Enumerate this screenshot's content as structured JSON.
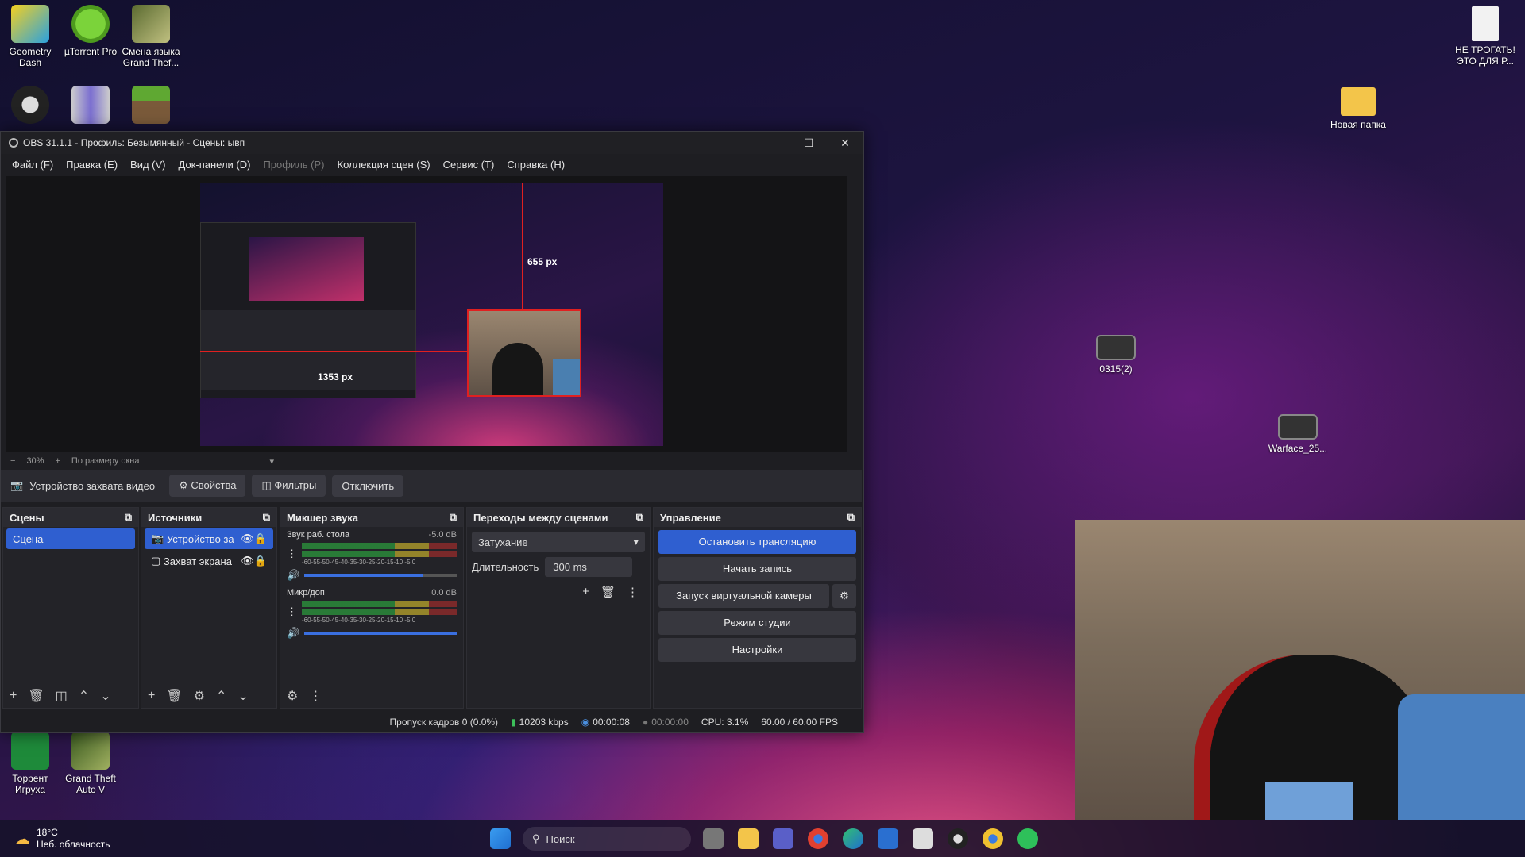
{
  "desktop": {
    "icons_left": [
      {
        "label": "Geometry Dash"
      },
      {
        "label": "µTorrent Pro"
      },
      {
        "label": "Смена языка Grand Thef..."
      },
      {
        "label": "Торрент Игруха"
      },
      {
        "label": "Grand Theft Auto V"
      }
    ],
    "icons_right": [
      {
        "label": "НЕ ТРОГАТЬ! ЭТО ДЛЯ Р..."
      },
      {
        "label": "Новая папка"
      },
      {
        "label": "0315(2)"
      },
      {
        "label": "Warface_25..."
      }
    ]
  },
  "obs": {
    "title": "OBS 31.1.1 - Профиль: Безымянный - Сцены: ывп",
    "menu": [
      "Файл (F)",
      "Правка (E)",
      "Вид (V)",
      "Док-панели (D)",
      "Профиль (P)",
      "Коллекция сцен (S)",
      "Сервис (T)",
      "Справка (H)"
    ],
    "preview": {
      "dim_vertical": "655 px",
      "dim_horizontal": "1353 px"
    },
    "zoom": {
      "minus": "−",
      "value": "30%",
      "plus": "+",
      "mode": "По размеру окна"
    },
    "source_toolbar": {
      "source_name": "Устройство захвата видео",
      "properties": "Свойства",
      "filters": "Фильтры",
      "disable": "Отключить"
    },
    "scenes": {
      "title": "Сцены",
      "items": [
        "Сцена"
      ]
    },
    "sources": {
      "title": "Источники",
      "items": [
        "Устройство за",
        "Захват экрана"
      ]
    },
    "mixer": {
      "title": "Микшер звука",
      "channels": [
        {
          "name": "Звук раб. стола",
          "db": "-5.0 dB",
          "volume": 0.78
        },
        {
          "name": "Микр/доп",
          "db": "0.0 dB",
          "volume": 1.0
        }
      ],
      "scale": "-60-55-50-45-40-35-30-25-20-15-10 -5  0"
    },
    "transitions": {
      "title": "Переходы между сценами",
      "selected": "Затухание",
      "duration_label": "Длительность",
      "duration_value": "300 ms"
    },
    "controls": {
      "title": "Управление",
      "stop_stream": "Остановить трансляцию",
      "start_record": "Начать запись",
      "virtual_cam": "Запуск виртуальной камеры",
      "studio_mode": "Режим студии",
      "settings": "Настройки"
    },
    "status": {
      "dropped": "Пропуск кадров 0 (0.0%)",
      "bitrate": "10203 kbps",
      "stream_time": "00:00:08",
      "rec_time": "00:00:00",
      "cpu": "CPU: 3.1%",
      "fps": "60.00 / 60.00 FPS"
    }
  },
  "taskbar": {
    "weather_temp": "18°C",
    "weather_desc": "Неб. облачность",
    "search_placeholder": "Поиск"
  }
}
